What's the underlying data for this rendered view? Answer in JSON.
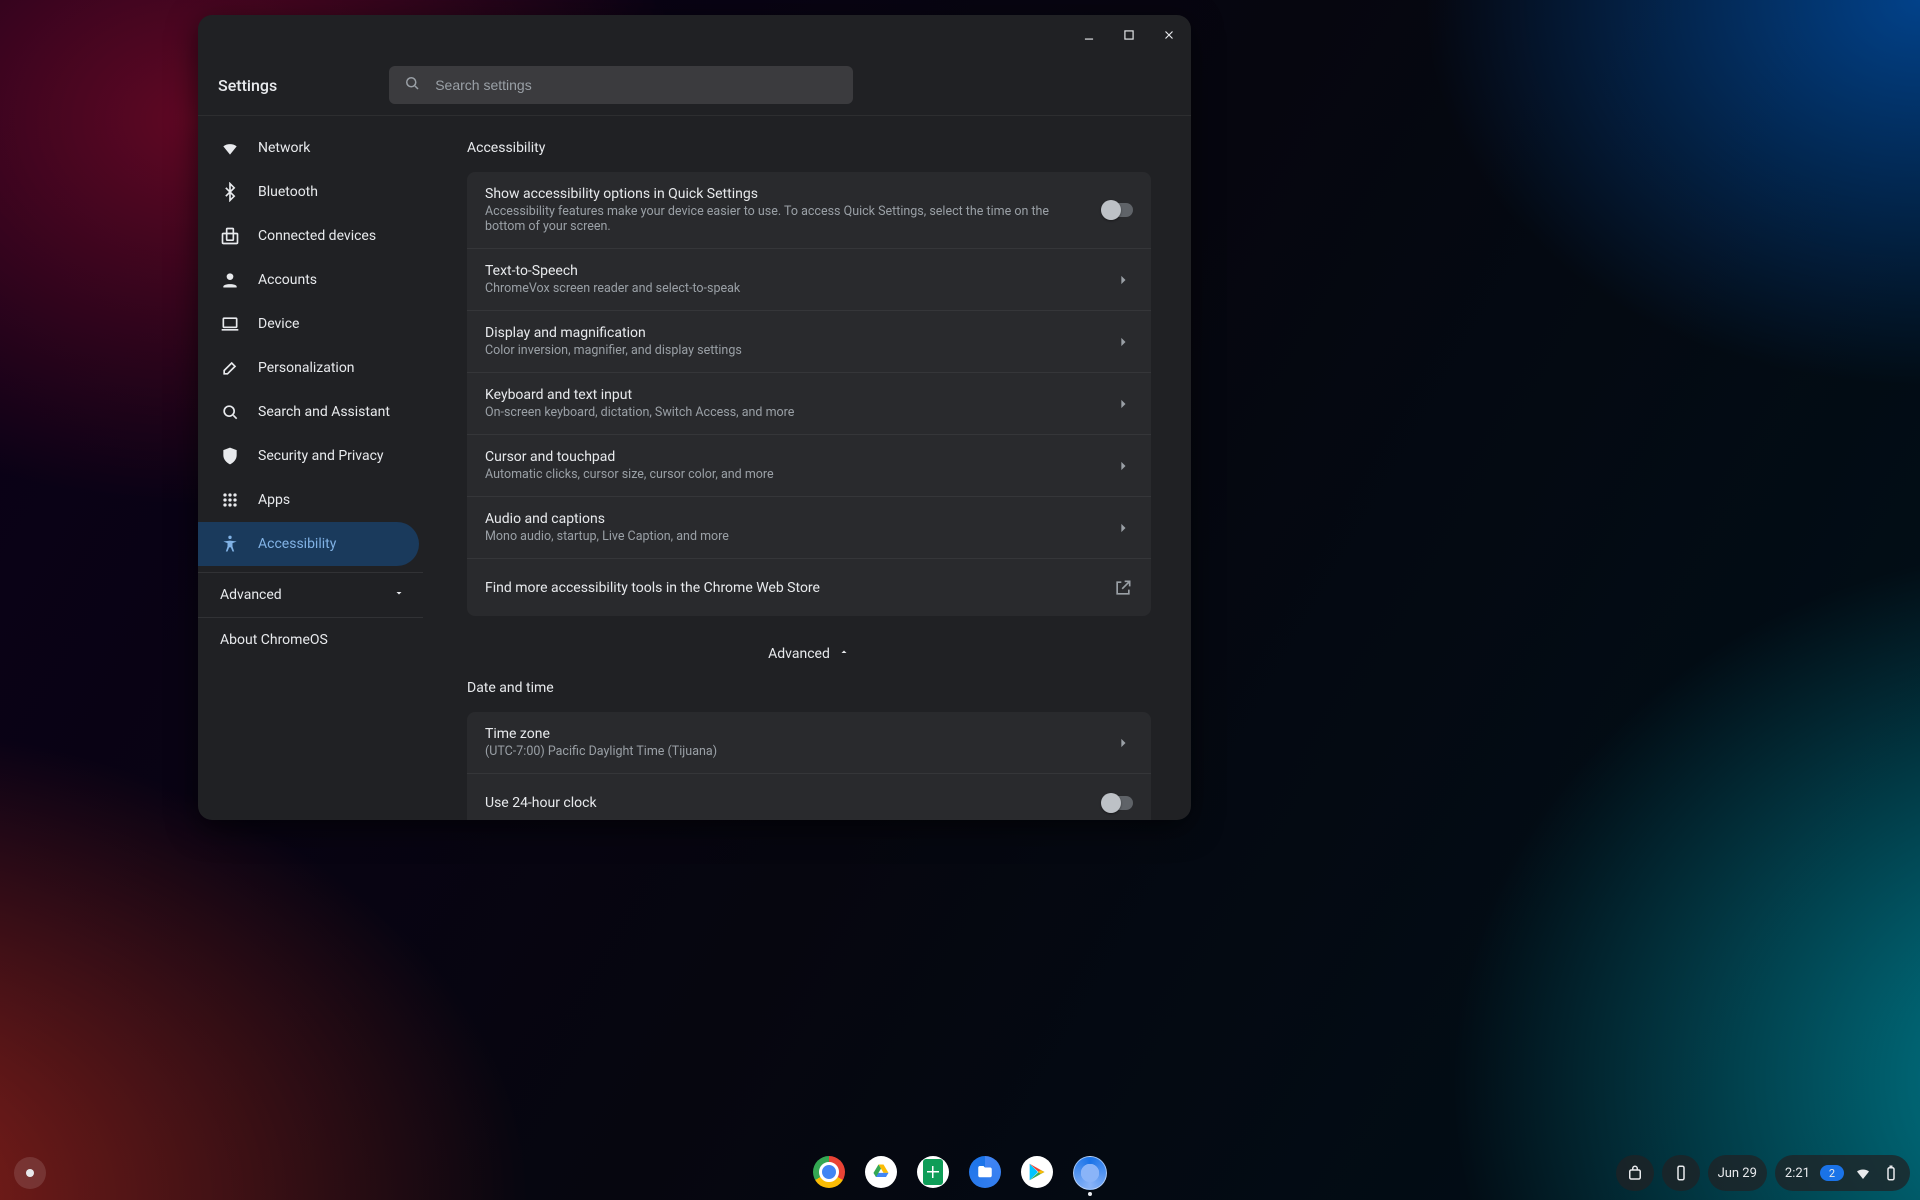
{
  "window": {
    "title": "Settings",
    "search_placeholder": "Search settings",
    "controls": {
      "minimize": "minimize-icon",
      "maximize": "maximize-icon",
      "close": "close-icon"
    }
  },
  "sidebar": {
    "items": [
      {
        "icon": "wifi-icon",
        "label": "Network"
      },
      {
        "icon": "bluetooth-icon",
        "label": "Bluetooth"
      },
      {
        "icon": "devices-icon",
        "label": "Connected devices"
      },
      {
        "icon": "person-icon",
        "label": "Accounts"
      },
      {
        "icon": "laptop-icon",
        "label": "Device"
      },
      {
        "icon": "brush-icon",
        "label": "Personalization"
      },
      {
        "icon": "search-icon",
        "label": "Search and Assistant"
      },
      {
        "icon": "shield-icon",
        "label": "Security and Privacy"
      },
      {
        "icon": "apps-icon",
        "label": "Apps"
      },
      {
        "icon": "accessibility-icon",
        "label": "Accessibility"
      }
    ],
    "advanced_label": "Advanced",
    "about_label": "About ChromeOS"
  },
  "content": {
    "section_accessibility": {
      "title": "Accessibility",
      "rows": [
        {
          "primary": "Show accessibility options in Quick Settings",
          "secondary": "Accessibility features make your device easier to use. To access Quick Settings, select the time on the bottom of your screen.",
          "control": "toggle_off"
        },
        {
          "primary": "Text-to-Speech",
          "secondary": "ChromeVox screen reader and select-to-speak",
          "control": "chevron"
        },
        {
          "primary": "Display and magnification",
          "secondary": "Color inversion, magnifier, and display settings",
          "control": "chevron"
        },
        {
          "primary": "Keyboard and text input",
          "secondary": "On-screen keyboard, dictation, Switch Access, and more",
          "control": "chevron"
        },
        {
          "primary": "Cursor and touchpad",
          "secondary": "Automatic clicks, cursor size, cursor color, and more",
          "control": "chevron"
        },
        {
          "primary": "Audio and captions",
          "secondary": "Mono audio, startup, Live Caption, and more",
          "control": "chevron"
        },
        {
          "primary": "Find more accessibility tools in the Chrome Web Store",
          "secondary": "",
          "control": "external"
        }
      ]
    },
    "advanced_label": "Advanced",
    "section_datetime": {
      "title": "Date and time",
      "rows": [
        {
          "primary": "Time zone",
          "secondary": "(UTC-7:00) Pacific Daylight Time (Tijuana)",
          "control": "chevron"
        },
        {
          "primary": "Use 24-hour clock",
          "secondary": "",
          "control": "toggle_off"
        }
      ]
    }
  },
  "shelf": {
    "apps": [
      {
        "name": "Chrome",
        "icon": "chrome-icon"
      },
      {
        "name": "Google Drive",
        "icon": "drive-icon"
      },
      {
        "name": "Google Sheets",
        "icon": "sheets-icon"
      },
      {
        "name": "Files",
        "icon": "files-icon"
      },
      {
        "name": "Play Store",
        "icon": "play-icon"
      },
      {
        "name": "Settings",
        "icon": "settings-icon",
        "active": true
      }
    ],
    "tray": {
      "date": "Jun 29",
      "time": "2:21",
      "notification_count": "2"
    }
  }
}
